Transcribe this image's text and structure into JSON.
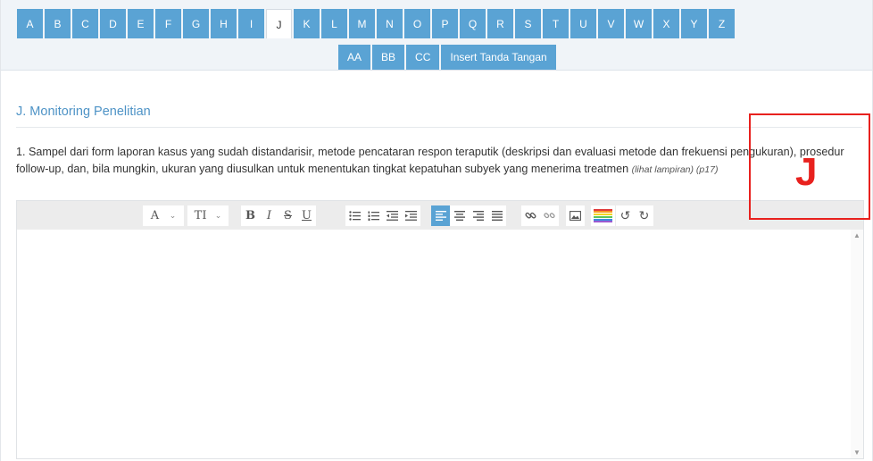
{
  "tabs": {
    "row1": [
      "A",
      "B",
      "C",
      "D",
      "E",
      "F",
      "G",
      "H",
      "I",
      "J",
      "K",
      "L",
      "M",
      "N",
      "O",
      "P",
      "Q",
      "R",
      "S",
      "T",
      "U",
      "V",
      "W",
      "X",
      "Y",
      "Z"
    ],
    "row2": [
      "AA",
      "BB",
      "CC",
      "Insert Tanda Tangan"
    ],
    "active": "J"
  },
  "section": {
    "title": "J. Monitoring Penelitian"
  },
  "question": {
    "text": "1. Sampel dari form laporan kasus yang sudah distandarisir, metode pencataran respon teraputik (deskripsi dan evaluasi metode dan frekuensi pengukuran), prosedur follow-up, dan, bila mungkin, ukuran yang diusulkan untuk menentukan tingkat kepatuhan subyek yang menerima treatmen",
    "hint": "(lihat lampiran) (p17)"
  },
  "editor": {
    "font_label": "A",
    "size_label": "TI",
    "bold": "B",
    "italic": "I",
    "strike": "S",
    "underline": "U",
    "value": ""
  },
  "annotation": {
    "letter": "J",
    "color": "#e8211e"
  },
  "colors": {
    "tab": "#5aa3d4",
    "accent_title": "#4e93c6",
    "active_button": "#5aa3d4"
  },
  "icons": {
    "unordered_list": "unordered-list-icon",
    "ordered_list": "ordered-list-icon",
    "outdent": "outdent-icon",
    "indent": "indent-icon",
    "align_left": "align-left-icon",
    "align_center": "align-center-icon",
    "align_right": "align-right-icon",
    "align_justify": "align-justify-icon",
    "link": "link-icon",
    "unlink": "unlink-icon",
    "image": "image-icon",
    "color": "text-color-icon",
    "undo": "undo-icon",
    "redo": "redo-icon"
  }
}
